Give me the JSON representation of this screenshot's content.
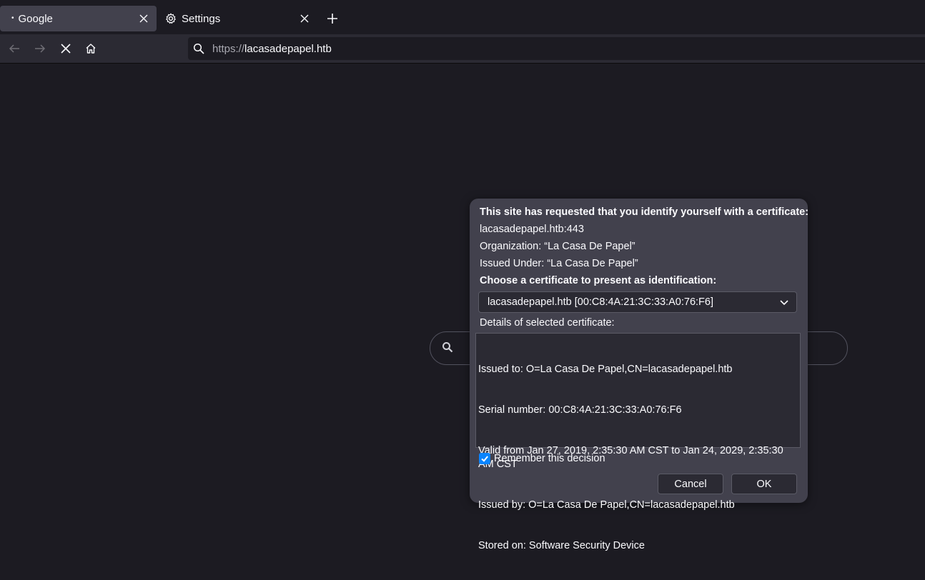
{
  "tabs": [
    {
      "label": "Google",
      "active": true
    },
    {
      "label": "Settings",
      "active": false
    }
  ],
  "toolbar": {
    "url_scheme": "https://",
    "url_host": "lacasadepapel.htb"
  },
  "dialog": {
    "heading": "This site has requested that you identify yourself with a certificate:",
    "host_port": "lacasadepapel.htb:443",
    "organization": "Organization: “La Casa De Papel”",
    "issued_under": "Issued Under: “La Casa De Papel”",
    "choose_label": "Choose a certificate to present as identification:",
    "selected_certificate": "lacasadepapel.htb [00:C8:4A:21:3C:33:A0:76:F6]",
    "details_label": "Details of selected certificate:",
    "details": [
      "Issued to: O=La Casa De Papel,CN=lacasadepapel.htb",
      "Serial number: 00:C8:4A:21:3C:33:A0:76:F6",
      "Valid from Jan 27, 2019, 2:35:30 AM CST to Jan 24, 2029, 2:35:30 AM CST",
      "Issued by: O=La Casa De Papel,CN=lacasadepapel.htb",
      "Stored on: Software Security Device"
    ],
    "remember_label": "Remember this decision",
    "remember_checked": true,
    "cancel_label": "Cancel",
    "ok_label": "OK"
  },
  "colors": {
    "background": "#1c1b22",
    "dialog": "#42414d",
    "accent": "#0a84ff"
  }
}
